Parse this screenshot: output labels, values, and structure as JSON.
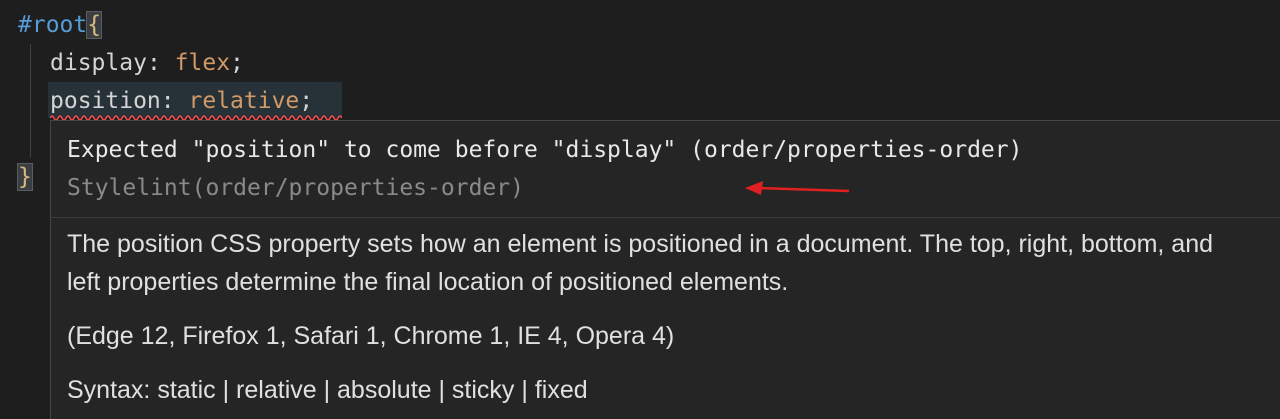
{
  "code": {
    "line1": {
      "selector": "#root",
      "brace": "{"
    },
    "line2": {
      "property": "display",
      "colon": ":",
      "value": "flex",
      "semicolon": ";"
    },
    "line3": {
      "property": "position",
      "colon": ":",
      "value": "relative",
      "semicolon": ";"
    },
    "line5": {
      "brace": "}"
    }
  },
  "hover": {
    "diagnostic_message": "Expected \"position\" to come before \"display\" (order/properties-order)",
    "diagnostic_source": "Stylelint(order/properties-order)",
    "description": "The position CSS property sets how an element is positioned in a document. The top, right, bottom, and left properties determine the final location of positioned elements.",
    "compat": "(Edge 12, Firefox 1, Safari 1, Chrome 1, IE 4, Opera 4)",
    "syntax": "Syntax: static | relative | absolute | sticky | fixed"
  },
  "colors": {
    "editor_bg": "#1e1e1e",
    "hover_bg": "#252526",
    "error_squiggle": "#f14c4c",
    "annotation_arrow": "#e02020"
  }
}
